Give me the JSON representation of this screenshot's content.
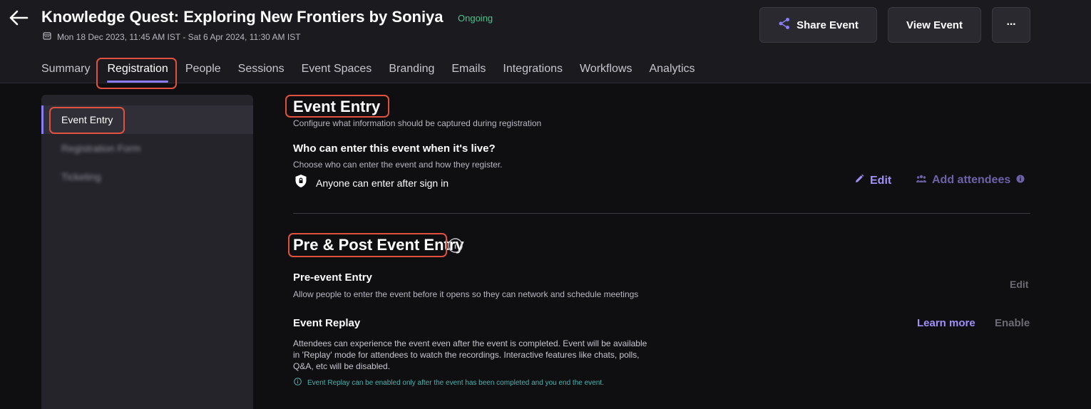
{
  "header": {
    "title": "Knowledge Quest: Exploring New Frontiers by Soniya",
    "status": "Ongoing",
    "dates": "Mon 18 Dec 2023, 11:45 AM IST - Sat 6 Apr 2024, 11:30 AM IST",
    "share_label": "Share Event",
    "view_label": "View Event",
    "more_label": "···"
  },
  "tabs": [
    {
      "label": "Summary"
    },
    {
      "label": "Registration"
    },
    {
      "label": "People"
    },
    {
      "label": "Sessions"
    },
    {
      "label": "Event Spaces"
    },
    {
      "label": "Branding"
    },
    {
      "label": "Emails"
    },
    {
      "label": "Integrations"
    },
    {
      "label": "Workflows"
    },
    {
      "label": "Analytics"
    }
  ],
  "sidebar": {
    "items": [
      {
        "label": "Event Entry"
      },
      {
        "label": "Registration Form"
      },
      {
        "label": "Ticketing"
      }
    ]
  },
  "event_entry": {
    "title": "Event Entry",
    "subtitle": "Configure what information should be captured during registration",
    "question": "Who can enter this event when it's live?",
    "question_sub": "Choose who can enter the event and how they register.",
    "access_text": "Anyone can enter after sign in",
    "edit_label": "Edit",
    "add_attendees_label": "Add attendees"
  },
  "pre_post": {
    "title": "Pre & Post Event Entry",
    "pre_title": "Pre-event Entry",
    "pre_desc": "Allow people to enter the event before it opens so they can network and schedule meetings",
    "pre_edit": "Edit",
    "replay_title": "Event Replay",
    "replay_desc": "Attendees can experience the event even after the event is completed. Event will be available in 'Replay' mode for attendees to watch the recordings. Interactive features like chats, polls, Q&A, etc will be disabled.",
    "learn_more": "Learn more",
    "enable": "Enable",
    "replay_note": "Event Replay can be enabled only after the event has been completed and you end the event."
  },
  "colors": {
    "accent": "#8b7cf6",
    "status_green": "#4cc38a",
    "highlight": "#e0523f",
    "note_teal": "#4ab3b0"
  }
}
